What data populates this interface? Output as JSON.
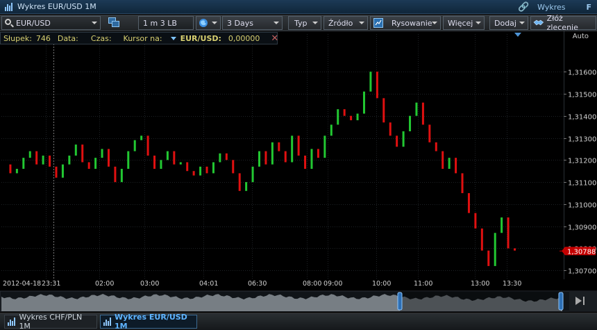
{
  "window": {
    "title": "Wykres EUR/USD 1M",
    "right_link": "Wykres",
    "right_key": "F"
  },
  "toolbar": {
    "symbol": "EUR/USD",
    "interval": "1 m 3 LB",
    "range": "3 Days",
    "type_label": "Typ",
    "source_label": "Źródło",
    "drawing_label": "Rysowanie",
    "more_label": "Więcej",
    "add_label": "Dodaj",
    "order_label": "Złóż zlecenie"
  },
  "infobar": {
    "bar_label": "Słupek:",
    "bar_value": "746",
    "date_label": "Data:",
    "time_label": "Czas:",
    "cursor_label": "Kursor na:",
    "instrument": "EUR/USD:",
    "instrument_value": "0,00000"
  },
  "axis": {
    "auto_label": "Auto"
  },
  "chart_data": {
    "type": "line",
    "style": "line-break",
    "symbol": "EUR/USD",
    "y_ticks": [
      "1,31600",
      "1,31500",
      "1,31400",
      "1,31300",
      "1,31200",
      "1,31100",
      "1,31000",
      "1,30900",
      "1,30800",
      "1,30700"
    ],
    "ylim": [
      1.3066,
      1.3172
    ],
    "x_ticks": [
      "2012-04-18",
      "23:31",
      "02:00",
      "03:00",
      "04:01",
      "06:30",
      "08:00",
      "09:00",
      "10:00",
      "11:00",
      "13:00",
      "13:30"
    ],
    "last_price": "1,30788",
    "last_value": 1.30788,
    "colors": {
      "up": "#22c832",
      "down": "#e01010",
      "background": "#000000",
      "last_price_bg": "#c40000"
    },
    "grid": true,
    "values": [
      1.3118,
      1.3114,
      1.3116,
      1.3121,
      1.3124,
      1.3118,
      1.3122,
      1.3117,
      1.3112,
      1.3118,
      1.3122,
      1.3127,
      1.3119,
      1.3116,
      1.3121,
      1.3125,
      1.3117,
      1.311,
      1.3116,
      1.3124,
      1.3129,
      1.3131,
      1.3122,
      1.3116,
      1.312,
      1.3124,
      1.3118,
      1.3119,
      1.3115,
      1.3113,
      1.3117,
      1.3114,
      1.3119,
      1.3123,
      1.312,
      1.3114,
      1.3106,
      1.311,
      1.3117,
      1.3124,
      1.3118,
      1.3128,
      1.3124,
      1.3119,
      1.3131,
      1.3122,
      1.3116,
      1.3125,
      1.3121,
      1.3131,
      1.3136,
      1.3143,
      1.314,
      1.3138,
      1.3141,
      1.3151,
      1.316,
      1.3148,
      1.3137,
      1.3131,
      1.3126,
      1.3133,
      1.314,
      1.3146,
      1.3136,
      1.3128,
      1.3124,
      1.3116,
      1.3121,
      1.3114,
      1.3105,
      1.3096,
      1.3089,
      1.3079,
      1.3072,
      1.3087,
      1.3094,
      1.308,
      1.3079
    ]
  }
}
